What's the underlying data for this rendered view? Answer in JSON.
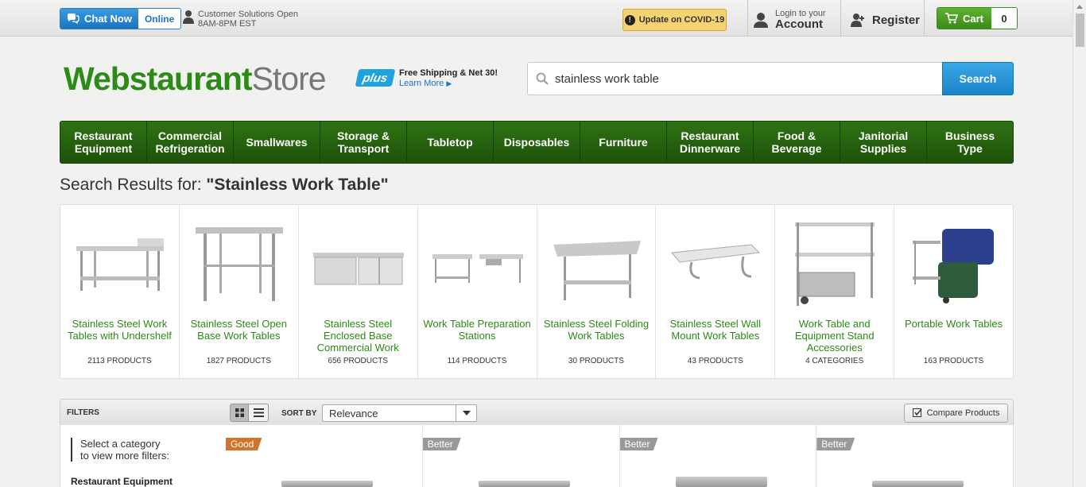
{
  "topbar": {
    "chat_label": "Chat Now",
    "chat_status": "Online",
    "hours_line1": "Customer Solutions Open",
    "hours_line2": "8AM-8PM EST",
    "covid_label": "Update on COVID-19",
    "login_small": "Login to your",
    "login_big": "Account",
    "register_label": "Register",
    "cart_label": "Cart",
    "cart_count": "0"
  },
  "header": {
    "logo_part1": "Webstaurant",
    "logo_part2": "Store",
    "plus_label": "plus",
    "plus_line1": "Free Shipping & Net 30!",
    "plus_line2": "Learn More",
    "search_value": "stainless work table",
    "search_button": "Search"
  },
  "nav": [
    {
      "line1": "Restaurant",
      "line2": "Equipment"
    },
    {
      "line1": "Commercial",
      "line2": "Refrigeration"
    },
    {
      "line1": "Smallwares",
      "line2": ""
    },
    {
      "line1": "Storage &",
      "line2": "Transport"
    },
    {
      "line1": "Tabletop",
      "line2": ""
    },
    {
      "line1": "Disposables",
      "line2": ""
    },
    {
      "line1": "Furniture",
      "line2": ""
    },
    {
      "line1": "Restaurant",
      "line2": "Dinnerware"
    },
    {
      "line1": "Food &",
      "line2": "Beverage"
    },
    {
      "line1": "Janitorial",
      "line2": "Supplies"
    },
    {
      "line1": "Business",
      "line2": "Type"
    }
  ],
  "results": {
    "prefix": "Search Results for: ",
    "query": "\"Stainless Work Table\""
  },
  "categories": [
    {
      "name": "Stainless Steel Work Tables with Undershelf",
      "count": "2113 PRODUCTS"
    },
    {
      "name": "Stainless Steel Open Base Work Tables",
      "count": "1827 PRODUCTS"
    },
    {
      "name": "Stainless Steel Enclosed Base Commercial Work",
      "count": "656 PRODUCTS"
    },
    {
      "name": "Work Table Preparation Stations",
      "count": "114 PRODUCTS"
    },
    {
      "name": "Stainless Steel Folding Work Tables",
      "count": "30 PRODUCTS"
    },
    {
      "name": "Stainless Steel Wall Mount Work Tables",
      "count": "43 PRODUCTS"
    },
    {
      "name": "Work Table and Equipment Stand Accessories",
      "count": "4 CATEGORIES"
    },
    {
      "name": "Portable Work Tables",
      "count": "163 PRODUCTS"
    }
  ],
  "filters": {
    "heading": "FILTERS",
    "select_line1": "Select a category",
    "select_line2": "to view more filters:",
    "first_category": "Restaurant Equipment"
  },
  "sortbar": {
    "sort_label": "SORT BY",
    "sort_value": "Relevance",
    "compare_label": "Compare Products"
  },
  "products": [
    {
      "tag": "Good",
      "tag_type": "good"
    },
    {
      "tag": "Better",
      "tag_type": "better"
    },
    {
      "tag": "Better",
      "tag_type": "better"
    },
    {
      "tag": "Better",
      "tag_type": "better"
    }
  ],
  "colors": {
    "brand_green": "#2c8a17",
    "nav_green": "#21570f",
    "search_blue": "#1a83c9",
    "good_tag": "#d0742e",
    "better_tag": "#9a9a9a"
  }
}
